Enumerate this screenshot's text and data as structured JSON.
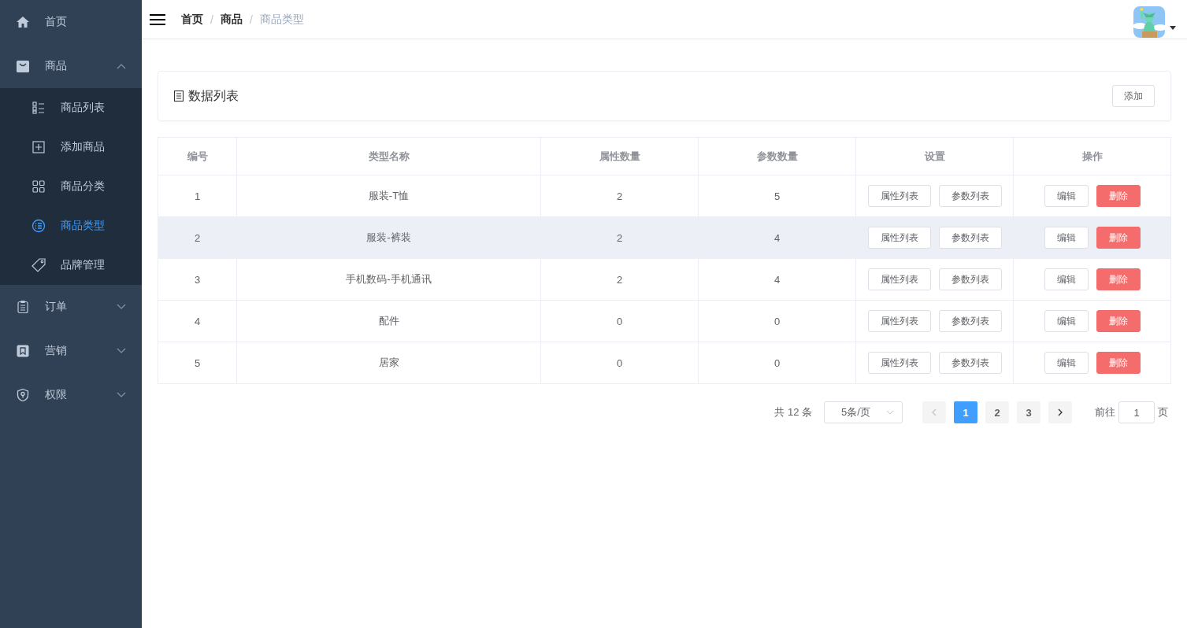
{
  "sidebar": {
    "items": [
      {
        "label": "首页",
        "kind": "home"
      },
      {
        "label": "商品",
        "kind": "bag",
        "expanded": true,
        "children": [
          {
            "label": "商品列表",
            "kind": "list",
            "selected": false
          },
          {
            "label": "添加商品",
            "kind": "plus-box",
            "selected": false
          },
          {
            "label": "商品分类",
            "kind": "grid",
            "selected": false
          },
          {
            "label": "商品类型",
            "kind": "circle-list",
            "selected": true
          },
          {
            "label": "品牌管理",
            "kind": "tag",
            "selected": false
          }
        ]
      },
      {
        "label": "订单",
        "kind": "clipboard",
        "expanded": false
      },
      {
        "label": "营销",
        "kind": "bookmark",
        "expanded": false
      },
      {
        "label": "权限",
        "kind": "shield",
        "expanded": false
      }
    ]
  },
  "header": {
    "breadcrumb": [
      {
        "label": "首页",
        "current": false
      },
      {
        "separator": "/",
        "label": "商品",
        "current": false
      },
      {
        "separator": "/",
        "label": "商品类型",
        "current": true
      }
    ]
  },
  "card": {
    "title": "数据列表",
    "button": "添加"
  },
  "table": {
    "columns": [
      "编号",
      "类型名称",
      "属性数量",
      "参数数量",
      "设置",
      "操作"
    ],
    "rows": [
      {
        "selected": false,
        "cells": [
          "1",
          "服装-T恤",
          "2",
          "5"
        ],
        "settings": [
          "属性列表",
          "参数列表"
        ],
        "actions": [
          {
            "label": "编辑",
            "kind": "default"
          },
          {
            "label": "删除",
            "kind": "danger"
          }
        ]
      },
      {
        "selected": true,
        "cells": [
          "2",
          "服装-裤装",
          "2",
          "4"
        ],
        "settings": [
          "属性列表",
          "参数列表"
        ],
        "actions": [
          {
            "label": "编辑",
            "kind": "default"
          },
          {
            "label": "删除",
            "kind": "danger"
          }
        ]
      },
      {
        "selected": false,
        "cells": [
          "3",
          "手机数码-手机通讯",
          "2",
          "4"
        ],
        "settings": [
          "属性列表",
          "参数列表"
        ],
        "actions": [
          {
            "label": "编辑",
            "kind": "default"
          },
          {
            "label": "删除",
            "kind": "danger"
          }
        ]
      },
      {
        "selected": false,
        "cells": [
          "4",
          "配件",
          "0",
          "0"
        ],
        "settings": [
          "属性列表",
          "参数列表"
        ],
        "actions": [
          {
            "label": "编辑",
            "kind": "default"
          },
          {
            "label": "删除",
            "kind": "danger"
          }
        ]
      },
      {
        "selected": false,
        "cells": [
          "5",
          "居家",
          "0",
          "0"
        ],
        "settings": [
          "属性列表",
          "参数列表"
        ],
        "actions": [
          {
            "label": "编辑",
            "kind": "default"
          },
          {
            "label": "删除",
            "kind": "danger"
          }
        ]
      }
    ]
  },
  "pagination": {
    "total": "共 12 条",
    "page_size": "5条/页",
    "prev_disabled": true,
    "next_disabled": false,
    "pages": [
      {
        "label": "1",
        "selected": true
      },
      {
        "label": "2",
        "selected": false
      },
      {
        "label": "3",
        "selected": false
      }
    ],
    "goto_label": "前往",
    "goto_value": "1",
    "goto_suffix": "页"
  }
}
